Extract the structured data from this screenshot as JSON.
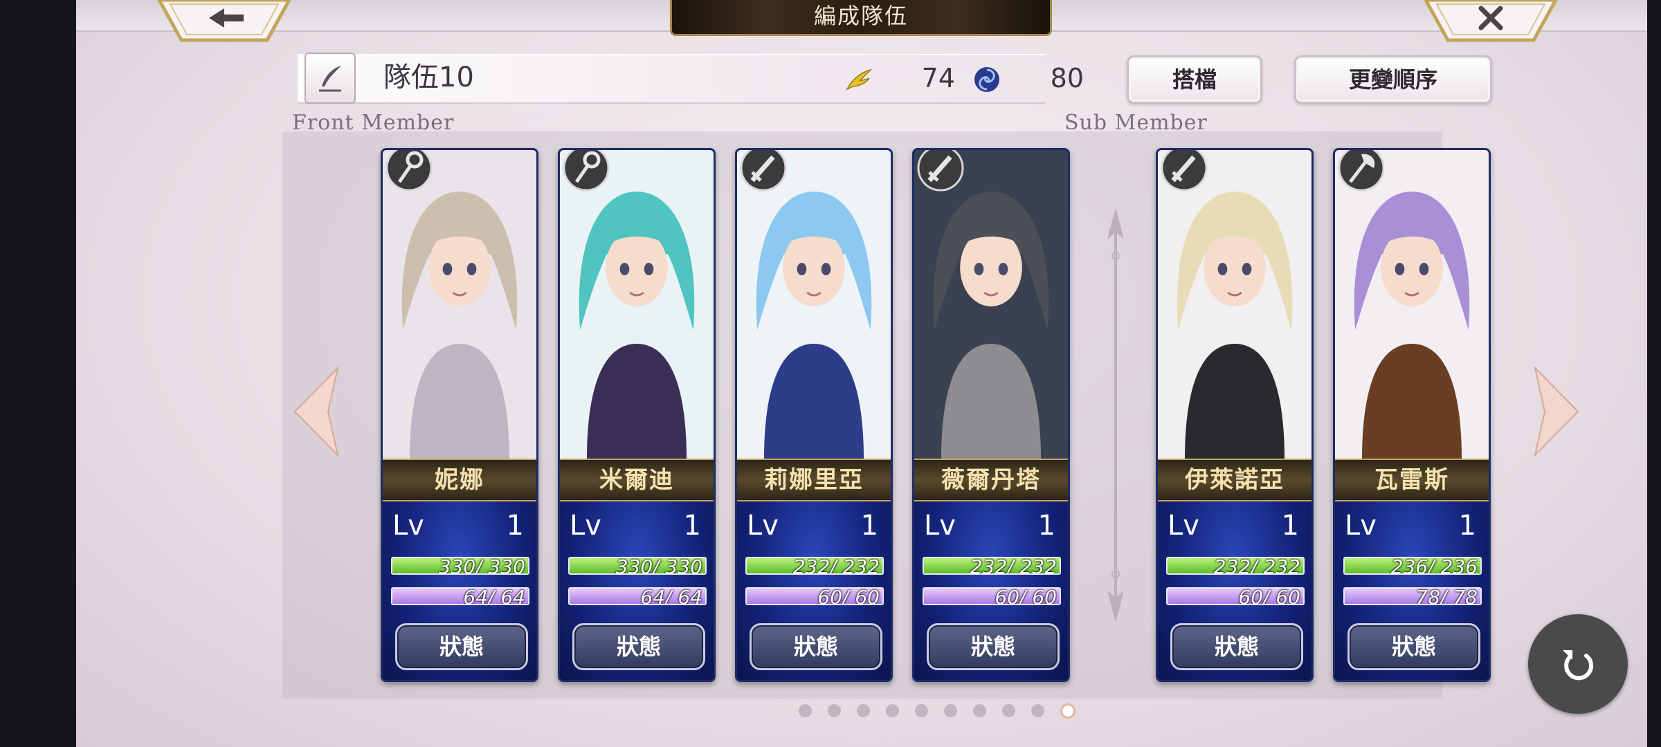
{
  "header": {
    "title": "編成隊伍"
  },
  "team": {
    "name": "隊伍10",
    "stat1_value": "74",
    "stat2_value": "80",
    "partner_label": "搭檔",
    "reorder_label": "更變順序"
  },
  "sections": {
    "front_label": "Front Member",
    "sub_label": "Sub Member"
  },
  "cards": [
    {
      "name": "妮娜",
      "lv_label": "Lv",
      "lv": "1",
      "hp": "330/ 330",
      "hp_frac": 1.0,
      "mp": "64/ 64",
      "mp_frac": 1.0,
      "status_label": "狀態",
      "class_icon": "staff-icon",
      "hair": "#cdbfae",
      "bg": "#eae4ea",
      "outfit": "#bdb5c4"
    },
    {
      "name": "米爾迪",
      "lv_label": "Lv",
      "lv": "1",
      "hp": "330/ 330",
      "hp_frac": 1.0,
      "mp": "64/ 64",
      "mp_frac": 1.0,
      "status_label": "狀態",
      "class_icon": "staff-icon",
      "hair": "#4fc4c0",
      "bg": "#e9f2f4",
      "outfit": "#3a2d56"
    },
    {
      "name": "莉娜里亞",
      "lv_label": "Lv",
      "lv": "1",
      "hp": "232/ 232",
      "hp_frac": 1.0,
      "mp": "60/ 60",
      "mp_frac": 1.0,
      "status_label": "狀態",
      "class_icon": "sword-icon",
      "hair": "#8cc8ef",
      "bg": "#eef3f8",
      "outfit": "#2d3d8a"
    },
    {
      "name": "薇爾丹塔",
      "lv_label": "Lv",
      "lv": "1",
      "hp": "232/ 232",
      "hp_frac": 1.0,
      "mp": "60/ 60",
      "mp_frac": 1.0,
      "status_label": "狀態",
      "class_icon": "sword-icon",
      "hair": "#4a4f58",
      "bg": "#3a4150",
      "outfit": "#8e8c90"
    },
    {
      "name": "伊萊諾亞",
      "lv_label": "Lv",
      "lv": "1",
      "hp": "232/ 232",
      "hp_frac": 1.0,
      "mp": "60/ 60",
      "mp_frac": 1.0,
      "status_label": "狀態",
      "class_icon": "sword-icon",
      "hair": "#e8dcb6",
      "bg": "#f2eff0",
      "outfit": "#2a2a2e"
    },
    {
      "name": "瓦雷斯",
      "lv_label": "Lv",
      "lv": "1",
      "hp": "236/ 236",
      "hp_frac": 1.0,
      "mp": "78/ 78",
      "mp_frac": 1.0,
      "status_label": "狀態",
      "class_icon": "axe-icon",
      "hair": "#a98fd6",
      "bg": "#f2eef2",
      "outfit": "#6a3e22"
    }
  ],
  "pagination": {
    "total": 10,
    "current": 10
  },
  "colors": {
    "hp_fill": "#7ed23e",
    "mp_fill": "#c7a0f2",
    "card_bg": "#14237a",
    "gold_trim": "#c4a462"
  }
}
